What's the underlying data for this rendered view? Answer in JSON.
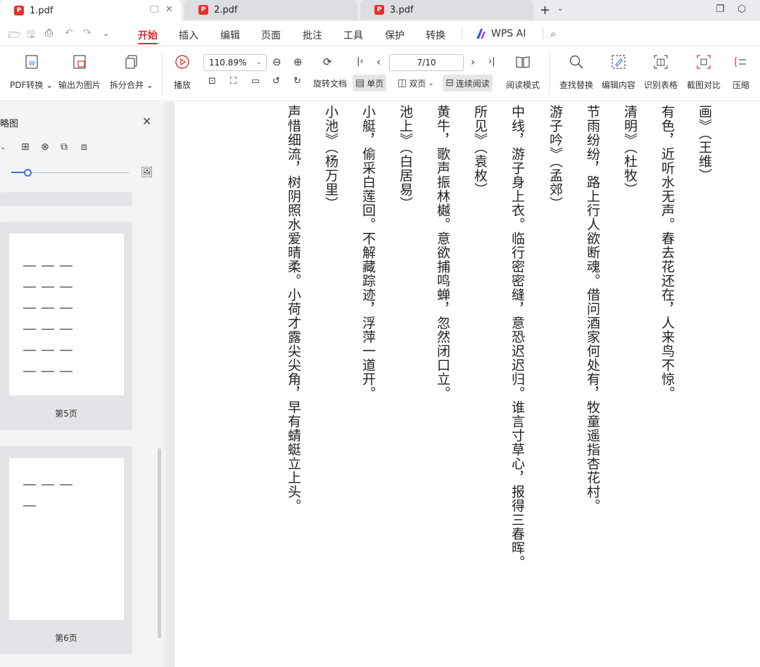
{
  "tabs": [
    {
      "title": "1.pdf",
      "active": true
    },
    {
      "title": "2.pdf",
      "active": false
    },
    {
      "title": "3.pdf",
      "active": false
    }
  ],
  "tab_icon_text": "P",
  "menu": [
    "开始",
    "插入",
    "编辑",
    "页面",
    "批注",
    "工具",
    "保护",
    "转换"
  ],
  "wps_ai": "WPS AI",
  "ribbon": {
    "pdf_convert": "PDF转换",
    "export_image": "输出为图片",
    "split_merge": "拆分合并",
    "play": "播放",
    "zoom_value": "110.89%",
    "page_indicator": "7/10",
    "rotate": "旋转文档",
    "single_page": "单页",
    "double_page": "双页",
    "continuous": "连续阅读",
    "read_mode": "阅读模式",
    "find_replace": "查找替换",
    "edit_content": "编辑内容",
    "recognize_table": "识别表格",
    "screenshot_compare": "截图对比",
    "compress": "压缩"
  },
  "sidebar": {
    "title": "略图",
    "thumbnails": [
      {
        "label": "第5页"
      },
      {
        "label": "第6页"
      }
    ]
  },
  "document": {
    "columns": [
      "画》（王维）",
      "有色，近听水无声。春去花还在，人来鸟不惊。",
      "清明》（杜牧）",
      "节雨纷纷，路上行人欲断魂。借问酒家何处有，牧童遥指杏花村。",
      "游子吟》（孟郊）",
      "中线，游子身上衣。临行密密缝，意恐迟迟归。谁言寸草心，报得三春晖。",
      "所见》（袁枚）",
      "黄牛，歌声振林樾。意欲捕鸣蝉，忽然闭口立。",
      "池上》（白居易）",
      "小艇，偷采白莲回。不解藏踪迹，浮萍一道开。",
      "小池》（杨万里）",
      "声惜细流，树阴照水爱晴柔。小荷才露尖尖角，早有蜻蜓立上头。"
    ]
  },
  "colors": {
    "accent": "#d8262c",
    "pdf_badge": "#e0322e",
    "slider": "#3f6fd8"
  }
}
